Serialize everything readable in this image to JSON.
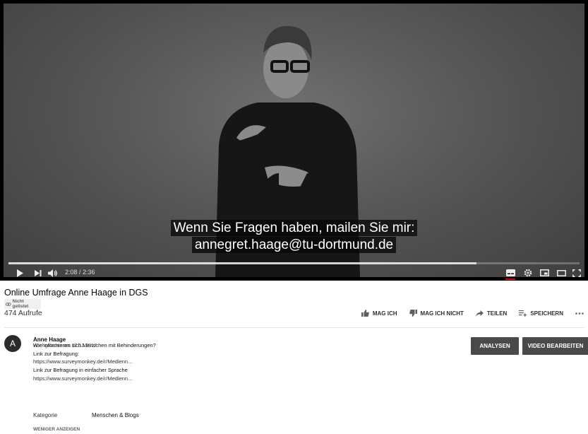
{
  "player": {
    "caption_line1": "Wenn Sie Fragen haben, mailen Sie mir:",
    "caption_line2": "annegret.haage@tu-dortmund.de",
    "time": "2:08 / 2:36",
    "progress": 0.82,
    "icons": [
      "play-icon",
      "next-icon",
      "volume-icon",
      "subtitles-icon",
      "settings-icon",
      "miniplayer-icon",
      "theater-icon",
      "fullscreen-icon"
    ]
  },
  "video": {
    "title": "Online Umfrage Anne Haage in DGS",
    "visibility": "Nicht gelistet",
    "views": "474 Aufrufe"
  },
  "actions": {
    "like": "MAG ICH",
    "dislike": "MAG ICH NICHT",
    "share": "TEILEN",
    "save": "SPEICHERN"
  },
  "channel": {
    "avatar_letter": "A",
    "name": "Anne Haage",
    "uploaded": "Hochgeladen am 27.12.2017",
    "analytics_button": "ANALYSEN",
    "edit_button": "VIDEO BEARBEITEN"
  },
  "description": {
    "lines": [
      "Wie informieren sich Menschen mit Behinderungen?",
      "Link zur Befragung:",
      "https://www.surveymonkey.de/r/Medienn...",
      "Link zur Befragung in einfacher Sprache",
      "https://www.surveymonkey.de/r/Medienn..."
    ],
    "category_label": "Kategorie",
    "category_value": "Menschen & Blogs",
    "show_less": "WENIGER ANZEIGEN"
  },
  "colors": {
    "player_bg": "#000000",
    "button_bg": "#4a4a4a",
    "caption_bg": "#080808"
  }
}
